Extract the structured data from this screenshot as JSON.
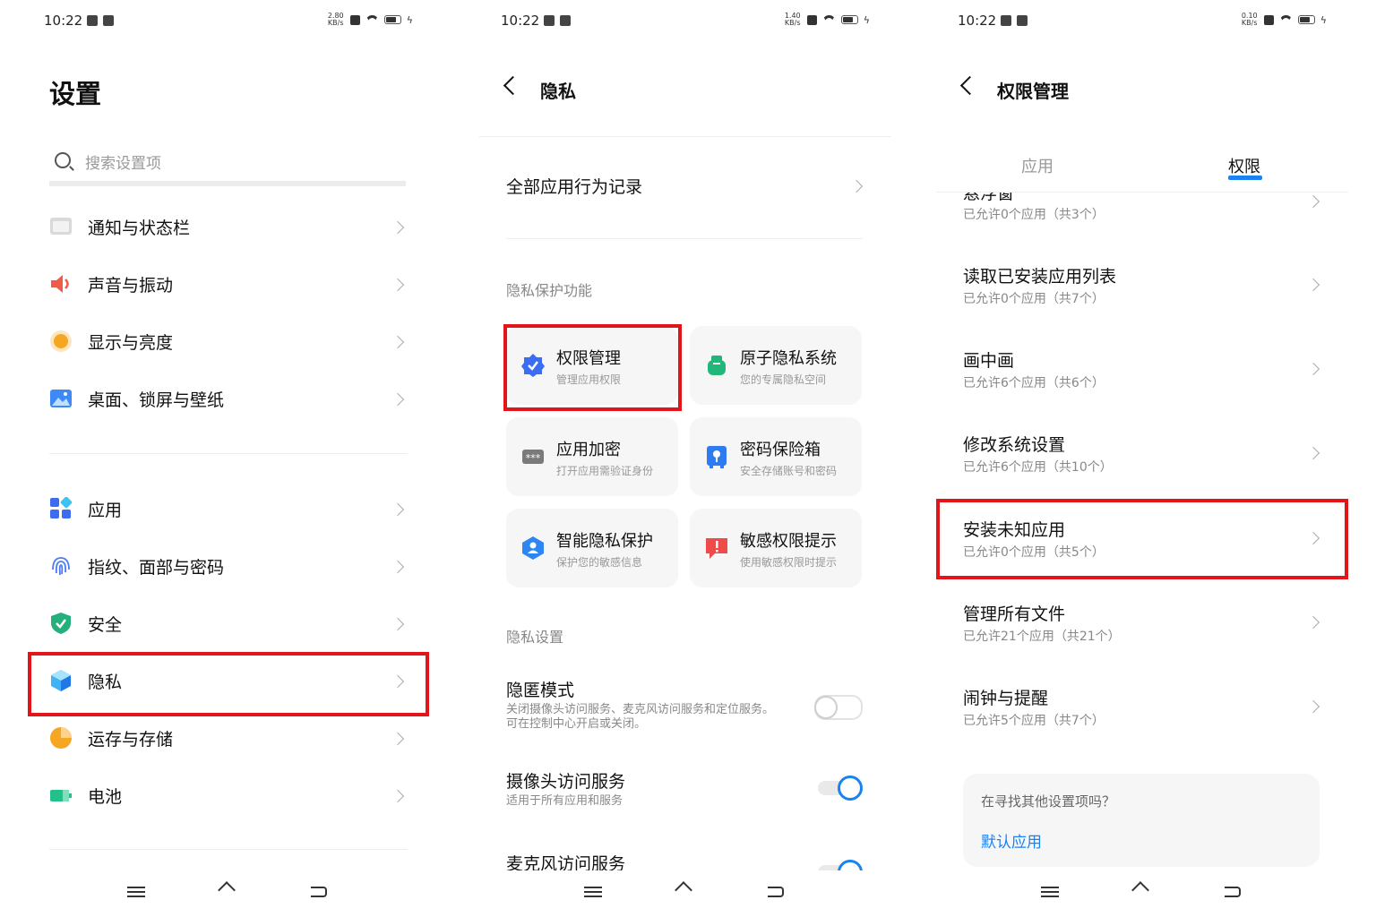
{
  "status_bars": [
    {
      "time": "10:22",
      "speed_top": "2.80",
      "speed_bottom": "KB/s"
    },
    {
      "time": "10:22",
      "speed_top": "1.40",
      "speed_bottom": "KB/s"
    },
    {
      "time": "10:22",
      "speed_top": "0.10",
      "speed_bottom": "KB/s"
    }
  ],
  "panel1": {
    "title": "设置",
    "search_placeholder": "搜索设置项",
    "items": [
      {
        "label": "通知与状态栏",
        "icon": "notification-icon",
        "color": "#cfcfcf"
      },
      {
        "label": "声音与振动",
        "icon": "speaker-icon",
        "color": "#f05a4a"
      },
      {
        "label": "显示与亮度",
        "icon": "brightness-icon",
        "color": "#f5a623"
      },
      {
        "label": "桌面、锁屏与壁纸",
        "icon": "wallpaper-icon",
        "color": "#3d8af7"
      },
      {
        "label": "应用",
        "icon": "apps-icon",
        "color": "#3d6cf0"
      },
      {
        "label": "指纹、面部与密码",
        "icon": "fingerprint-icon",
        "color": "#4a7cf5"
      },
      {
        "label": "安全",
        "icon": "shield-icon",
        "color": "#23b07c"
      },
      {
        "label": "隐私",
        "icon": "privacy-cube-icon",
        "color": "#2d9cf0"
      },
      {
        "label": "运存与存储",
        "icon": "storage-pie-icon",
        "color": "#f5a623"
      },
      {
        "label": "电池",
        "icon": "battery-icon",
        "color": "#22c08a"
      }
    ]
  },
  "panel2": {
    "title": "隐私",
    "top_item": "全部应用行为记录",
    "section1": "隐私保护功能",
    "cards": [
      {
        "title": "权限管理",
        "subtitle": "管理应用权限",
        "icon": "permission-badge-icon",
        "color": "#3a6cf4"
      },
      {
        "title": "原子隐私系统",
        "subtitle": "您的专属隐私空间",
        "icon": "atom-privacy-icon",
        "color": "#21b77a"
      },
      {
        "title": "应用加密",
        "subtitle": "打开应用需验证身份",
        "icon": "app-lock-icon",
        "color": "#7a7a7a"
      },
      {
        "title": "密码保险箱",
        "subtitle": "安全存储账号和密码",
        "icon": "safe-box-icon",
        "color": "#2f7cf0"
      },
      {
        "title": "智能隐私保护",
        "subtitle": "保护您的敏感信息",
        "icon": "smart-protect-icon",
        "color": "#2f86f0"
      },
      {
        "title": "敏感权限提示",
        "subtitle": "使用敏感权限时提示",
        "icon": "alert-icon",
        "color": "#ef4b4b"
      }
    ],
    "section2": "隐私设置",
    "settings": [
      {
        "title": "隐匿模式",
        "subtitle": "关闭摄像头访问服务、麦克风访问服务和定位服务。可在控制中心开启或关闭。",
        "on": false
      },
      {
        "title": "摄像头访问服务",
        "subtitle": "适用于所有应用和服务",
        "on": true
      },
      {
        "title": "麦克风访问服务",
        "subtitle": "",
        "on": true
      }
    ]
  },
  "panel3": {
    "title": "权限管理",
    "tabs": [
      "应用",
      "权限"
    ],
    "active_tab": "权限",
    "partial_title": "悬浮窗",
    "permissions": [
      {
        "title": "",
        "subtitle": "已允许0个应用（共3个）"
      },
      {
        "title": "读取已安装应用列表",
        "subtitle": "已允许0个应用（共7个）"
      },
      {
        "title": "画中画",
        "subtitle": "已允许6个应用（共6个）"
      },
      {
        "title": "修改系统设置",
        "subtitle": "已允许6个应用（共10个）"
      },
      {
        "title": "安装未知应用",
        "subtitle": "已允许0个应用（共5个）"
      },
      {
        "title": "管理所有文件",
        "subtitle": "已允许21个应用（共21个）"
      },
      {
        "title": "闹钟与提醒",
        "subtitle": "已允许5个应用（共7个）"
      }
    ],
    "help_question": "在寻找其他设置项吗？",
    "help_link": "默认应用"
  },
  "colors": {
    "highlight": "#e4141b",
    "accent": "#1b82f1"
  }
}
